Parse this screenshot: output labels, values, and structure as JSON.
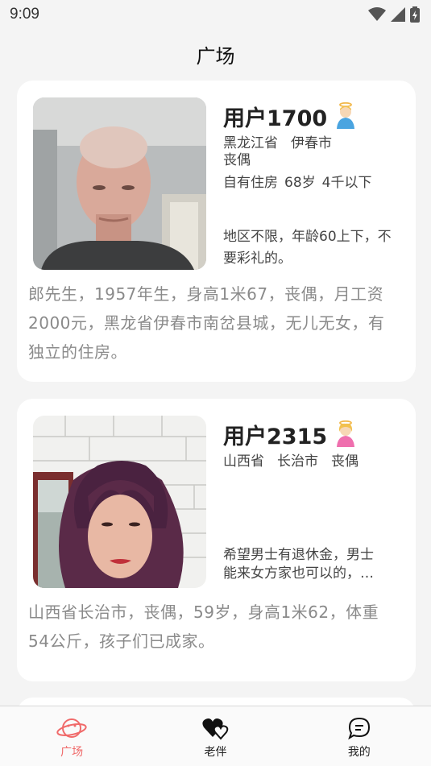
{
  "status_bar": {
    "time": "9:09"
  },
  "header": {
    "title": "广场"
  },
  "cards": [
    {
      "user_name": "用户1700",
      "gender": "male",
      "province": "黑龙江省",
      "city": "伊春市",
      "marital": "丧偶",
      "housing": "自有住房",
      "age": "68岁",
      "income": "4千以下",
      "requirement": "地区不限，年龄60上下，不要彩礼的。",
      "description": "郎先生，1957年生，身高1米67，丧偶，月工资2000元，黑龙省伊春市南岔县城，无儿无女，有独立的住房。"
    },
    {
      "user_name": "用户2315",
      "gender": "female",
      "province": "山西省",
      "city": "长治市",
      "marital": "丧偶",
      "requirement_line1": "希望男士有退休金，男士",
      "requirement_line2": "能来女方家也可以的，…",
      "description": "山西省长治市，丧偶，59岁，身高1米62，体重54公斤，孩子们已成家。"
    }
  ],
  "tabbar": {
    "tabs": [
      {
        "label": "广场",
        "icon": "planet-icon",
        "active": true
      },
      {
        "label": "老伴",
        "icon": "hearts-icon",
        "active": false
      },
      {
        "label": "我的",
        "icon": "chat-bubble-icon",
        "active": false
      }
    ],
    "active_color": "#f06a6a"
  }
}
